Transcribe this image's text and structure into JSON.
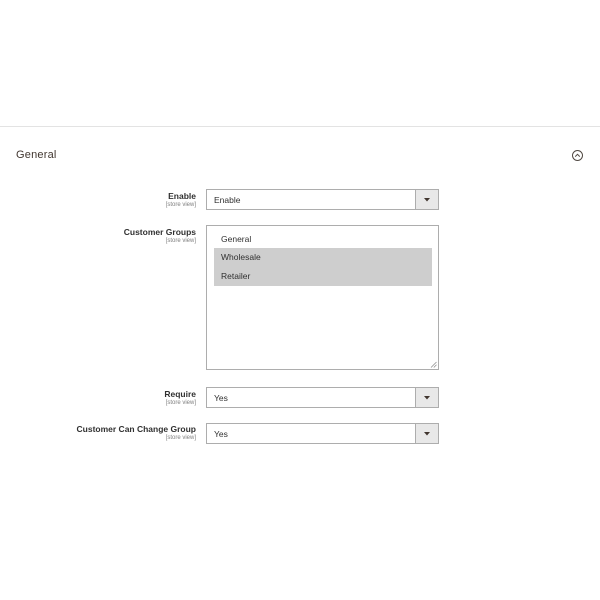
{
  "section": {
    "title": "General"
  },
  "fields": {
    "enable": {
      "label": "Enable",
      "scope": "[store view]",
      "value": "Enable"
    },
    "customer_groups": {
      "label": "Customer Groups",
      "scope": "[store view]",
      "options": [
        {
          "label": "General",
          "selected": false
        },
        {
          "label": "Wholesale",
          "selected": true
        },
        {
          "label": "Retailer",
          "selected": true
        }
      ]
    },
    "require": {
      "label": "Require",
      "scope": "[store view]",
      "value": "Yes"
    },
    "customer_can_change_group": {
      "label": "Customer Can Change Group",
      "scope": "[store view]",
      "value": "Yes"
    }
  },
  "icons": {
    "collapse": "chevron-up-circle-icon",
    "dropdown": "caret-down-icon",
    "resize": "resize-handle-icon"
  },
  "colors": {
    "selected_option_bg": "#cecece",
    "arrow_box_bg": "#e8e8e8",
    "border": "#adadad"
  }
}
